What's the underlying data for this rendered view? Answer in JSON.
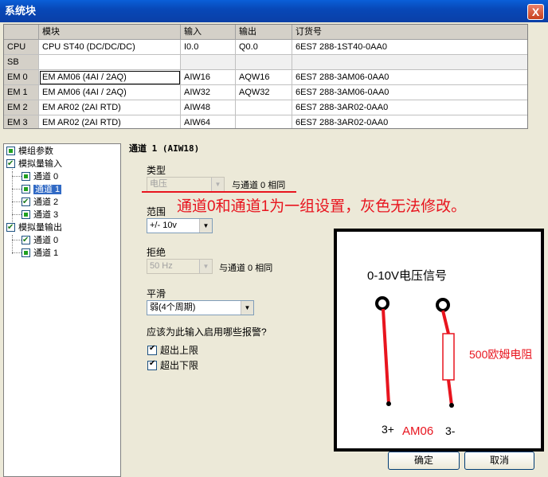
{
  "window": {
    "title": "系统块",
    "close_label": "X"
  },
  "table": {
    "headers": [
      "",
      "模块",
      "输入",
      "输出",
      "订货号"
    ],
    "rows": [
      {
        "slot": "CPU",
        "module": "CPU ST40 (DC/DC/DC)",
        "input": "I0.0",
        "output": "Q0.0",
        "order": "6ES7 288-1ST40-0AA0"
      },
      {
        "slot": "SB",
        "module": "",
        "input": "",
        "output": "",
        "order": ""
      },
      {
        "slot": "EM 0",
        "module": "EM AM06 (4AI / 2AQ)",
        "input": "AIW16",
        "output": "AQW16",
        "order": "6ES7 288-3AM06-0AA0"
      },
      {
        "slot": "EM 1",
        "module": "EM AM06 (4AI / 2AQ)",
        "input": "AIW32",
        "output": "AQW32",
        "order": "6ES7 288-3AM06-0AA0"
      },
      {
        "slot": "EM 2",
        "module": "EM AR02 (2AI RTD)",
        "input": "AIW48",
        "output": "",
        "order": "6ES7 288-3AR02-0AA0"
      },
      {
        "slot": "EM 3",
        "module": "EM AR02 (2AI RTD)",
        "input": "AIW64",
        "output": "",
        "order": "6ES7 288-3AR02-0AA0"
      }
    ]
  },
  "tree": {
    "module_params": "模组参数",
    "analog_input": "模拟量输入",
    "input_channels": [
      "通道 0",
      "通道 1",
      "通道 2",
      "通道 3"
    ],
    "analog_output": "模拟量输出",
    "output_channels": [
      "通道 0",
      "通道 1"
    ]
  },
  "props": {
    "title": "通道 1 (AIW18)",
    "type_label": "类型",
    "type_value": "电压",
    "same_as_ch0_1": "与通道 0 相同",
    "range_label": "范围",
    "range_value": "+/- 10v",
    "reject_label": "拒绝",
    "reject_value": "50 Hz",
    "same_as_ch0_2": "与通道 0 相同",
    "smooth_label": "平滑",
    "smooth_value": "弱(4个周期)",
    "alarm_question": "应该为此输入启用哪些报警?",
    "alarm_upper": "超出上限",
    "alarm_lower": "超出下限"
  },
  "annotation": "通道0和通道1为一组设置，灰色无法修改。",
  "diagram": {
    "title": "0-10V电压信号",
    "resistor": "500欧姆电阻",
    "term_plus": "3+",
    "module": "AM06",
    "term_minus": "3-"
  },
  "buttons": {
    "ok": "确定",
    "cancel": "取消"
  },
  "colors": {
    "annotation_red": "#e8141e",
    "selection_blue": "#316ac5"
  }
}
